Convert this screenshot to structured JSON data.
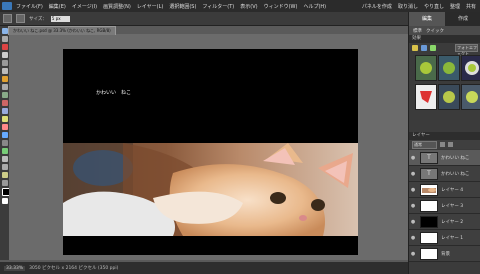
{
  "menu": {
    "items": [
      "ファイル(F)",
      "編集(E)",
      "イメージ(I)",
      "画質調整(N)",
      "レイヤー(L)",
      "選択範囲(S)",
      "フィルター(T)",
      "表示(V)",
      "ウィンドウ(W)",
      "ヘルプ(H)"
    ],
    "right": [
      "パネルを作成",
      "取り消し",
      "やり直し",
      "整理",
      "共有"
    ]
  },
  "options": {
    "size_label": "サイズ：",
    "size_value": "5 px"
  },
  "document": {
    "tab_title": "かわいい ねこ.psd @ 33.3% (かわいい ねこ, RGB/8)",
    "text": "かわいい　ねこ"
  },
  "status": {
    "zoom": "33.33%",
    "info": "3050 ピクセル x 2164 ピクセル (350 ppi)"
  },
  "panel": {
    "tabs": [
      "編集",
      "作成"
    ],
    "subtabs": [
      "標準",
      "クイック"
    ],
    "effects_title": "効果",
    "effects_dropdown": "フォトエフェクト",
    "layers_title": "レイヤー",
    "blend_mode": "通常",
    "layers": [
      {
        "name": "かわいい ねこ",
        "type": "text",
        "active": true
      },
      {
        "name": "かわいい ねこ",
        "type": "text",
        "active": false
      },
      {
        "name": "レイヤー 4",
        "type": "photo",
        "active": false
      },
      {
        "name": "レイヤー 3",
        "type": "white",
        "active": false
      },
      {
        "name": "レイヤー 2",
        "type": "black",
        "active": false
      },
      {
        "name": "レイヤー 1",
        "type": "white",
        "active": false
      },
      {
        "name": "背景",
        "type": "white",
        "active": false
      }
    ]
  },
  "colors": {
    "accent": "#3a78b9",
    "canvas_bg": "#6b6b6b",
    "document_bg": "#000000"
  }
}
